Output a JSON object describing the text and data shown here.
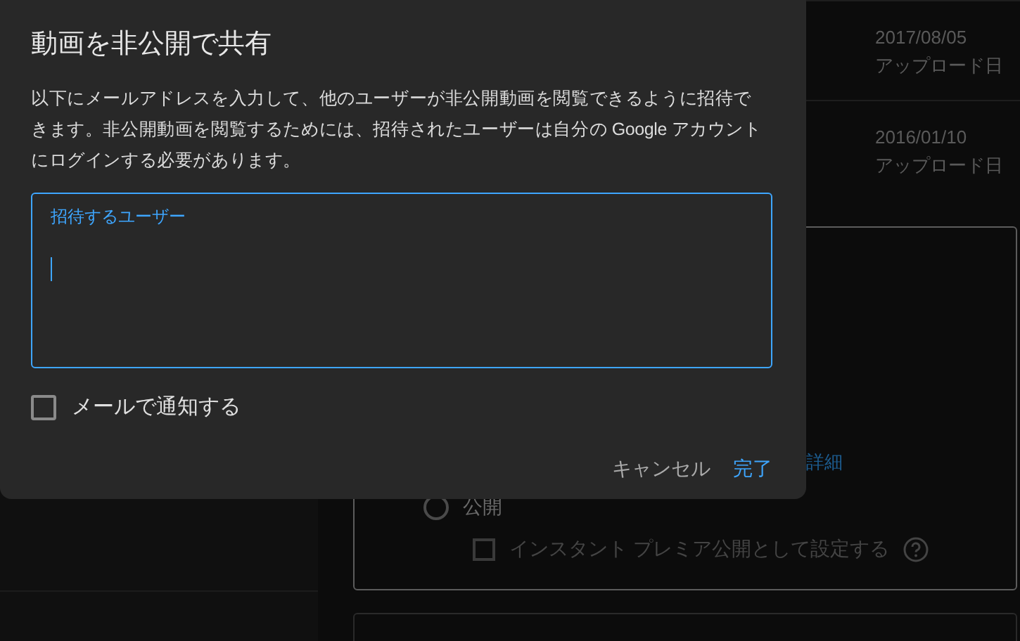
{
  "dialog": {
    "title": "動画を非公開で共有",
    "description": "以下にメールアドレスを入力して、他のユーザーが非公開動画を閲覧できるように招待できます。非公開動画を閲覧するためには、招待されたユーザーは自分の Google アカウントにログインする必要があります。",
    "field": {
      "label": "招待するユーザー",
      "focused": true
    },
    "notify": {
      "label": "メールで通知する",
      "checked": false
    },
    "buttons": [
      {
        "label": "キャンセル",
        "kind": "text"
      },
      {
        "label": "完了",
        "kind": "primary"
      }
    ]
  },
  "background": {
    "videos": [
      {
        "date": "2017/08/05",
        "date_label": "アップロード日"
      },
      {
        "date": "2016/01/10",
        "date_label": "アップロード日"
      }
    ],
    "visibility": {
      "link": "詳細",
      "options": [
        {
          "label": "公開",
          "selected": false
        }
      ],
      "premiere": {
        "label": "インスタント プレミア公開として設定する",
        "checked": false
      }
    }
  }
}
